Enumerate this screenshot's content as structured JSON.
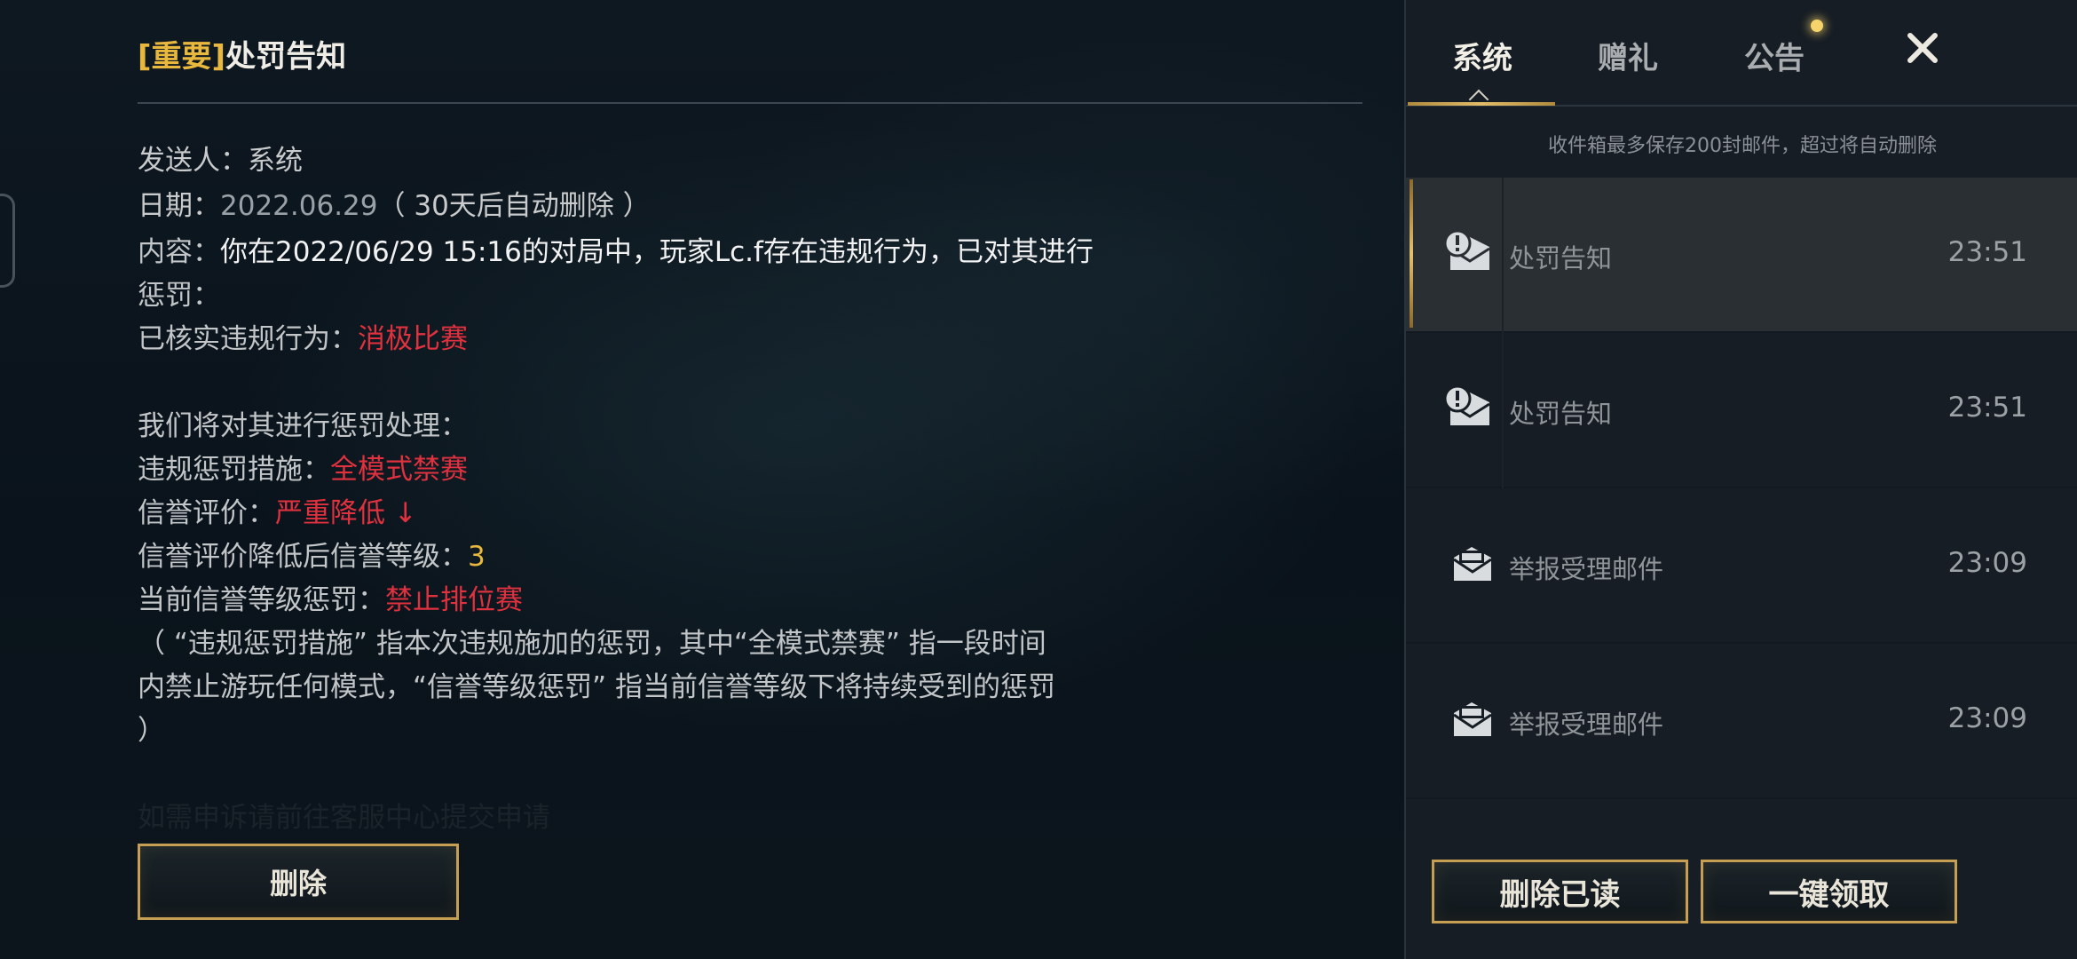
{
  "side_code": "14903169",
  "detail": {
    "title_tag": "[重要]",
    "title": "处罚告知",
    "sender_label": "发送人：",
    "sender": "系统",
    "date_label": "日期：",
    "date": "2022.06.29",
    "date_note": "（ 30天后自动删除 ）",
    "content_label": "内容：",
    "content_line1": "你在2022/06/29 15:16的对局中，玩家Lc.f存在违规行为，已对其进行",
    "content_line2": "惩罚：",
    "verified_label": "已核实违规行为：",
    "verified_value": "消极比赛",
    "intro": "我们将对其进行惩罚处理：",
    "measure_label": "违规惩罚措施：",
    "measure_value": "全模式禁赛",
    "credit_label": "信誉评价：",
    "credit_value": "严重降低 ↓",
    "level_label": "信誉评价降低后信誉等级：",
    "level_value": "3",
    "current_label": "当前信誉等级惩罚：",
    "current_value": "禁止排位赛",
    "explain_line1": "（ “违规惩罚措施” 指本次违规施加的惩罚，其中“全模式禁赛” 指一段时间",
    "explain_line2": "内禁止游玩任何模式，“信誉等级惩罚” 指当前信誉等级下将持续受到的惩罚",
    "explain_line3": "）",
    "faded_text": "如需申诉请前往客服中心提交申请",
    "delete_label": "删除"
  },
  "mail_panel": {
    "tabs": [
      "系统",
      "赠礼",
      "公告"
    ],
    "active_tab": 0,
    "capacity_note": "收件箱最多保存200封邮件，超过将自动删除",
    "mails": [
      {
        "title": "处罚告知",
        "time": "23:51",
        "icon": "important-mail-icon",
        "selected": true
      },
      {
        "title": "处罚告知",
        "time": "23:51",
        "icon": "important-mail-icon",
        "selected": false
      },
      {
        "title": "举报受理邮件",
        "time": "23:09",
        "icon": "mail-icon",
        "selected": false
      },
      {
        "title": "举报受理邮件",
        "time": "23:09",
        "icon": "mail-icon",
        "selected": false
      }
    ],
    "delete_read_label": "删除已读",
    "claim_all_label": "一键领取"
  },
  "colors": {
    "gold": "#e7b73e",
    "red": "#e0313f",
    "button_border": "#c79f52",
    "notice_dot": "#f6d36b"
  }
}
